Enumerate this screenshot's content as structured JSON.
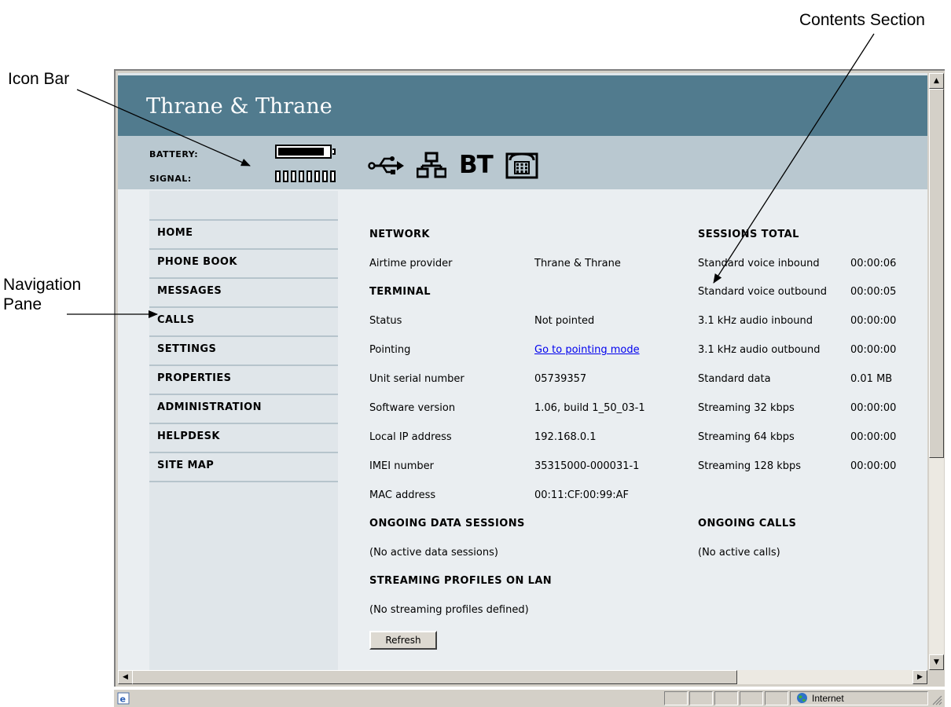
{
  "annotations": {
    "icon_bar": "Icon Bar",
    "contents_section": "Contents Section",
    "navigation_pane": "Navigation\nPane"
  },
  "header": {
    "brand": "Thrane & Thrane",
    "battery_label": "BATTERY:",
    "signal_label": "SIGNAL:",
    "battery_level": 0.9,
    "signal_bars": 8,
    "status_icons": [
      "usb-icon",
      "lan-icon",
      "bluetooth-icon",
      "phone-icon"
    ],
    "bt_text": "BT"
  },
  "nav": {
    "items": [
      "HOME",
      "PHONE BOOK",
      "MESSAGES",
      "CALLS",
      "SETTINGS",
      "PROPERTIES",
      "ADMINISTRATION",
      "HELPDESK",
      "SITE MAP"
    ]
  },
  "content": {
    "network": {
      "heading": "NETWORK",
      "rows": [
        {
          "label": "Airtime provider",
          "value": "Thrane & Thrane"
        }
      ]
    },
    "terminal": {
      "heading": "TERMINAL",
      "rows": [
        {
          "label": "Status",
          "value": "Not pointed"
        },
        {
          "label": "Pointing",
          "value": "Go to pointing mode"
        },
        {
          "label": "Unit serial number",
          "value": "05739357"
        },
        {
          "label": "Software version",
          "value": "1.06, build 1_50_03-1"
        },
        {
          "label": "Local IP address",
          "value": "192.168.0.1"
        },
        {
          "label": "IMEI number",
          "value": "35315000-000031-1"
        },
        {
          "label": "MAC address",
          "value": "00:11:CF:00:99:AF"
        }
      ]
    },
    "sessions_total": {
      "heading": "SESSIONS TOTAL",
      "rows": [
        {
          "label": "Standard voice inbound",
          "value": "00:00:06"
        },
        {
          "label": "Standard voice outbound",
          "value": "00:00:05"
        },
        {
          "label": "3.1 kHz audio inbound",
          "value": "00:00:00"
        },
        {
          "label": "3.1 kHz audio outbound",
          "value": "00:00:00"
        },
        {
          "label": "Standard data",
          "value": "0.01 MB"
        },
        {
          "label": "Streaming 32 kbps",
          "value": "00:00:00"
        },
        {
          "label": "Streaming 64 kbps",
          "value": "00:00:00"
        },
        {
          "label": "Streaming 128 kbps",
          "value": "00:00:00"
        }
      ]
    },
    "ongoing_data": {
      "heading": "ONGOING DATA SESSIONS",
      "text": "(No active data sessions)"
    },
    "ongoing_calls": {
      "heading": "ONGOING CALLS",
      "text": "(No active calls)"
    },
    "streaming": {
      "heading": "STREAMING PROFILES ON LAN",
      "text": "(No streaming profiles defined)"
    },
    "refresh_label": "Refresh"
  },
  "browser_status": {
    "zone": "Internet"
  },
  "colors": {
    "brand_bar": "#517b8e",
    "status_bar": "#b9c8d0",
    "page_bg": "#eaeef1",
    "link": "#0000ee"
  }
}
